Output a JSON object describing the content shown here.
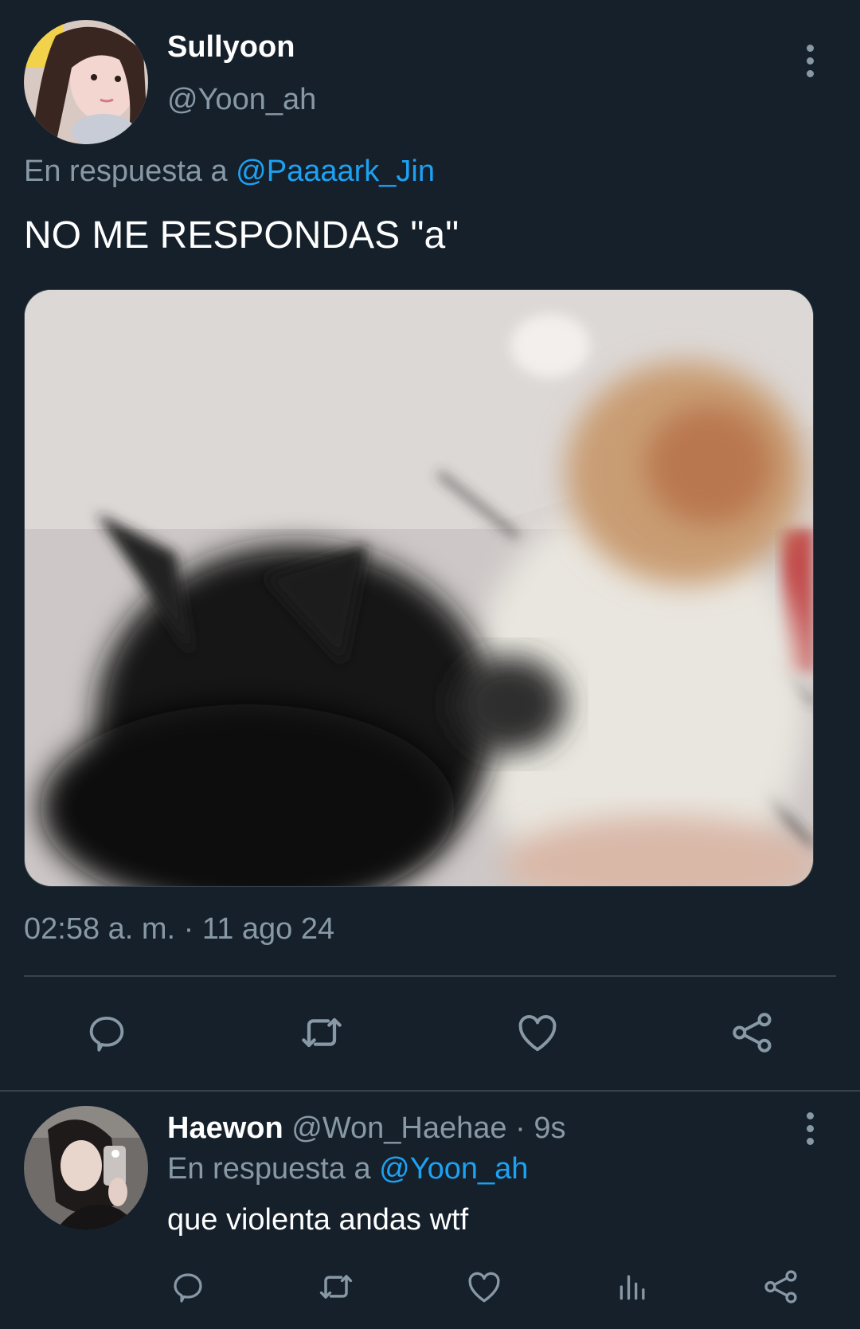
{
  "main_tweet": {
    "display_name": "Sullyoon",
    "handle": "@Yoon_ah",
    "reply_prefix": "En respuesta a",
    "reply_to": "@Paaaark_Jin",
    "text": "NO ME RESPONDAS \"a\"",
    "timestamp": "02:58 a. m. · 11 ago 24"
  },
  "reply_tweet": {
    "display_name": "Haewon",
    "handle": "@Won_Haehae",
    "time": "· 9s",
    "reply_prefix": "En respuesta a",
    "reply_to": "@Yoon_ah",
    "text": "que violenta andas wtf"
  },
  "colors": {
    "background": "#15202b",
    "muted": "#8899a6",
    "link": "#1da1f2",
    "divider": "#38444d"
  },
  "icons": {
    "reply": "reply-icon",
    "retweet": "retweet-icon",
    "like": "heart-icon",
    "share": "share-icon",
    "analytics": "analytics-icon",
    "more": "more-vertical-icon"
  }
}
